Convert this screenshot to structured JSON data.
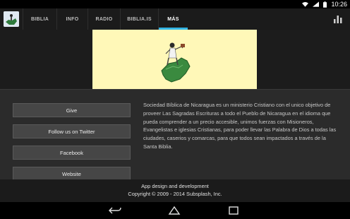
{
  "status_bar": {
    "time": "10:26",
    "icons": [
      "wifi-icon",
      "signal-icon",
      "battery-icon"
    ]
  },
  "app_bar": {
    "logo": "bible-society-logo",
    "tabs": [
      {
        "label": "BIBLIA",
        "active": false
      },
      {
        "label": "INFO",
        "active": false
      },
      {
        "label": "RADIO",
        "active": false
      },
      {
        "label": "BIBLIA.IS",
        "active": false
      },
      {
        "label": "MÁS",
        "active": true
      }
    ],
    "accent_color": "#33b5e5",
    "action_icon": "bar-chart-icon"
  },
  "buttons": [
    {
      "label": "Give"
    },
    {
      "label": "Follow us on Twitter"
    },
    {
      "label": "Facebook"
    },
    {
      "label": "Website"
    }
  ],
  "description": "Sociedad Bíblica de Nicaragua es un ministerio Cristiano con el unico objetivo de proveer Las Sagradas Escrituras a todo el Pueblo de Nicaragua en el idioma que pueda comprender a un precio accesible, unimos fuerzas con Misioneros, Evangelistas e iglesias Cristianas, para poder llevar las Palabra de Dios a todas las ciudades, caserios y comarcas, para que todos sean impactados a través de la Santa Biblia.",
  "footer": {
    "line1": "App design and development",
    "line2": "Copyright © 2009 - 2014 Subsplash, Inc."
  },
  "nav_bar": {
    "icons": [
      "back-icon",
      "home-icon",
      "recent-apps-icon"
    ]
  }
}
